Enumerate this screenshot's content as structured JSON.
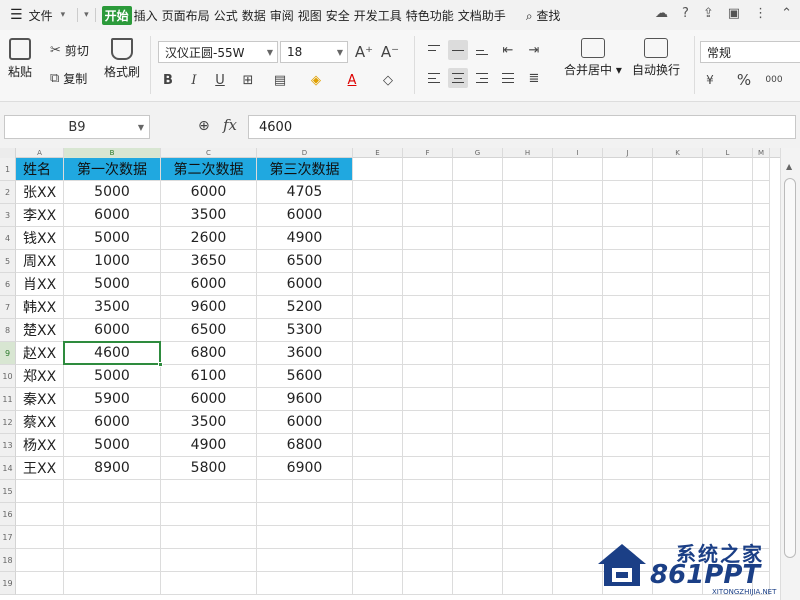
{
  "menubar": {
    "file_label": "文件",
    "items": [
      {
        "label": "开始",
        "active": true
      },
      {
        "label": "插入"
      },
      {
        "label": "页面布局"
      },
      {
        "label": "公式"
      },
      {
        "label": "数据"
      },
      {
        "label": "审阅"
      },
      {
        "label": "视图"
      },
      {
        "label": "安全"
      },
      {
        "label": "开发工具"
      },
      {
        "label": "特色功能"
      },
      {
        "label": "文档助手"
      }
    ],
    "search_label": "查找",
    "accent_color": "#2b9a3a"
  },
  "ribbon": {
    "paste_label": "粘贴",
    "cut_label": "剪切",
    "copy_label": "复制",
    "format_painter_label": "格式刷",
    "font_name": "汉仪正圆-55W",
    "font_size": "18",
    "merge_label": "合并居中",
    "wrap_label": "自动换行",
    "number_format": "常规",
    "percent_symbol": "%",
    "thousands_symbol": "000",
    "grow_font": "A⁺",
    "shrink_font": "A⁻"
  },
  "formula_bar": {
    "name_box": "B9",
    "fx_label": "fx",
    "value": "4600"
  },
  "grid": {
    "columns": [
      "A",
      "B",
      "C",
      "D",
      "E",
      "F",
      "G",
      "H",
      "I",
      "J",
      "K",
      "L",
      "M"
    ],
    "selected_column": "B",
    "selected_row": 9,
    "header_color": "#20a8e0",
    "headers": [
      "姓名",
      "第一次数据",
      "第二次数据",
      "第三次数据"
    ],
    "rows": [
      [
        "张XX",
        "5000",
        "6000",
        "4705"
      ],
      [
        "李XX",
        "6000",
        "3500",
        "6000"
      ],
      [
        "钱XX",
        "5000",
        "2600",
        "4900"
      ],
      [
        "周XX",
        "1000",
        "3650",
        "6500"
      ],
      [
        "肖XX",
        "5000",
        "6000",
        "6000"
      ],
      [
        "韩XX",
        "3500",
        "9600",
        "5200"
      ],
      [
        "楚XX",
        "6000",
        "6500",
        "5300"
      ],
      [
        "赵XX",
        "4600",
        "6800",
        "3600"
      ],
      [
        "郑XX",
        "5000",
        "6100",
        "5600"
      ],
      [
        "秦XX",
        "5900",
        "6000",
        "9600"
      ],
      [
        "蔡XX",
        "6000",
        "3500",
        "6000"
      ],
      [
        "杨XX",
        "5000",
        "4900",
        "6800"
      ],
      [
        "王XX",
        "8900",
        "5800",
        "6900"
      ]
    ],
    "row_numbers": [
      "1",
      "2",
      "3",
      "4",
      "5",
      "6",
      "7",
      "8",
      "9",
      "10",
      "11",
      "12",
      "13",
      "14",
      "15",
      "16",
      "17",
      "18",
      "19"
    ]
  },
  "watermark": {
    "cn_text": "系统之家",
    "en_text": "861PPT",
    "url_text": "XITONGZHIJIA.NET"
  }
}
